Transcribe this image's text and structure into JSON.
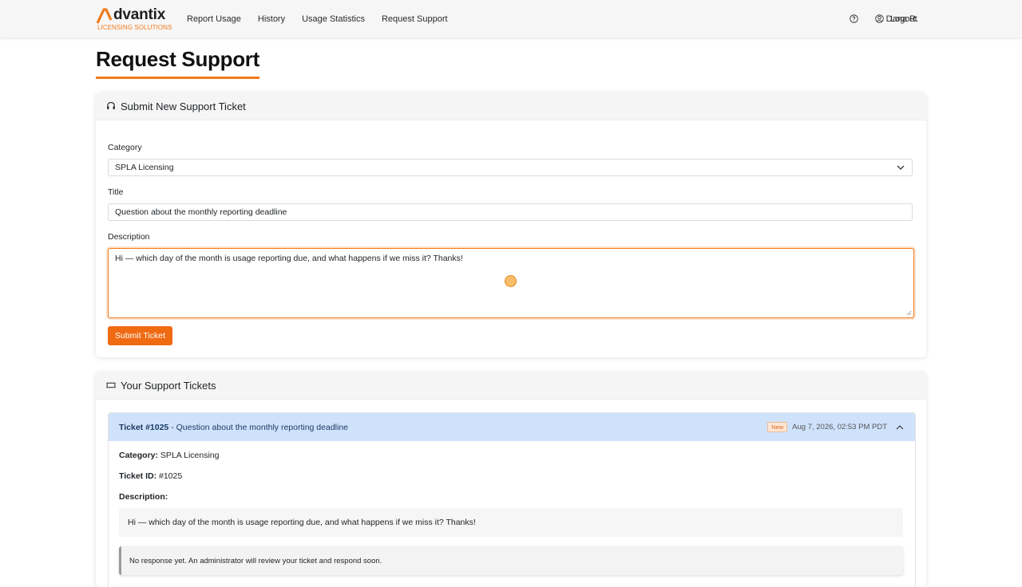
{
  "brand": {
    "name": "dvantix",
    "tagline": "LICENSING SOLUTIONS",
    "accent": "#f07b1c"
  },
  "nav": {
    "links": [
      "Report Usage",
      "History",
      "Usage Statistics",
      "Request Support"
    ],
    "help_icon": "question-circle-icon",
    "user_name": "Dana R.",
    "logout": "Logout"
  },
  "page": {
    "title": "Request Support"
  },
  "form": {
    "header": "Submit New Support Ticket",
    "header_icon": "headset-icon",
    "category_label": "Category",
    "category_value": "SPLA Licensing",
    "title_label": "Title",
    "title_value": "Question about the monthly reporting deadline",
    "description_label": "Description",
    "description_value": "Hi — which day of the month is usage reporting due, and what happens if we miss it? Thanks!",
    "submit_label": "Submit Ticket"
  },
  "tickets": {
    "header": "Your Support Tickets",
    "header_icon": "ticket-icon",
    "items": [
      {
        "number": "Ticket #1025",
        "title": " - Question about the monthly reporting deadline",
        "status": "New",
        "date": "Aug 7, 2026, 02:53 PM PDT",
        "category_label": "Category:",
        "category": " SPLA Licensing",
        "id_label": "Ticket ID:",
        "id": " #1025",
        "description_label": "Description:",
        "description": "Hi — which day of the month is usage reporting due, and what happens if we miss it? Thanks!",
        "response": "No response yet. An administrator will review your ticket and respond soon."
      }
    ]
  },
  "colors": {
    "primary": "#f06a12",
    "ticket_header_bg": "#cfe2fb",
    "badge_text": "#e0661a"
  }
}
